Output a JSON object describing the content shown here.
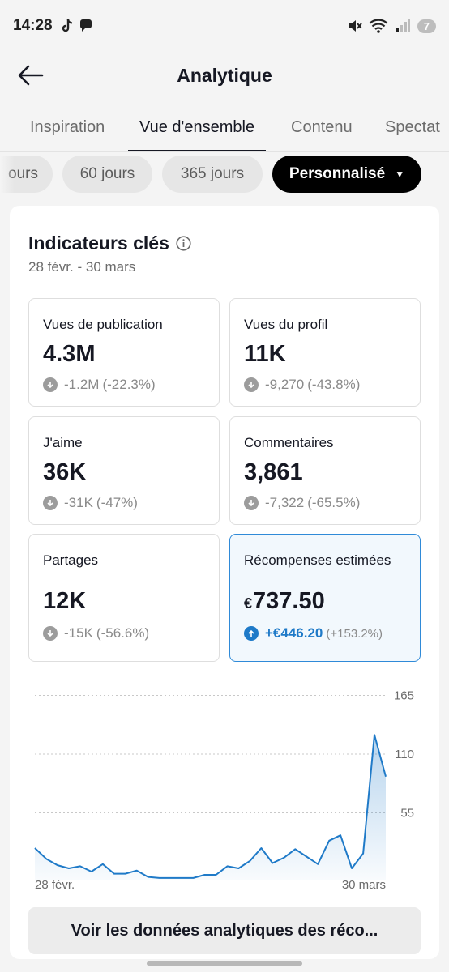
{
  "status": {
    "time": "14:28",
    "battery": "7"
  },
  "header": {
    "title": "Analytique"
  },
  "tabs": [
    {
      "label": "Inspiration"
    },
    {
      "label": "Vue d'ensemble"
    },
    {
      "label": "Contenu"
    },
    {
      "label": "Spectat"
    }
  ],
  "chips": [
    {
      "label": "ours"
    },
    {
      "label": "60 jours"
    },
    {
      "label": "365 jours"
    },
    {
      "label": "Personnalisé"
    }
  ],
  "section": {
    "title": "Indicateurs clés",
    "date_range": "28 févr. - 30 mars"
  },
  "metrics": [
    {
      "label": "Vues de publication",
      "value": "4.3M",
      "change": "-1.2M",
      "percent": "(-22.3%)"
    },
    {
      "label": "Vues du profil",
      "value": "11K",
      "change": "-9,270",
      "percent": "(-43.8%)"
    },
    {
      "label": "J'aime",
      "value": "36K",
      "change": "-31K",
      "percent": "(-47%)"
    },
    {
      "label": "Commentaires",
      "value": "3,861",
      "change": "-7,322",
      "percent": "(-65.5%)"
    },
    {
      "label": "Partages",
      "value": "12K",
      "change": "-15K",
      "percent": "(-56.6%)"
    },
    {
      "label": "Récompenses estimées",
      "currency": "€",
      "value": "737.50",
      "change": "+€446.20",
      "percent": "(+153.2%)"
    }
  ],
  "chart_data": {
    "type": "area",
    "y_ticks": [
      "165",
      "110",
      "55"
    ],
    "x_start_label": "28 févr.",
    "x_end_label": "30 mars",
    "ylim": [
      0,
      165
    ],
    "values": [
      22,
      12,
      6,
      3,
      5,
      0,
      7,
      -2,
      -2,
      1,
      -5,
      -6,
      -6,
      -6,
      -6,
      -3,
      -3,
      5,
      3,
      10,
      22,
      8,
      13,
      21,
      14,
      7,
      29,
      34,
      3,
      17,
      128,
      89
    ],
    "color": "#1f7ac8"
  },
  "cta": {
    "label": "Voir les données analytiques des réco..."
  }
}
